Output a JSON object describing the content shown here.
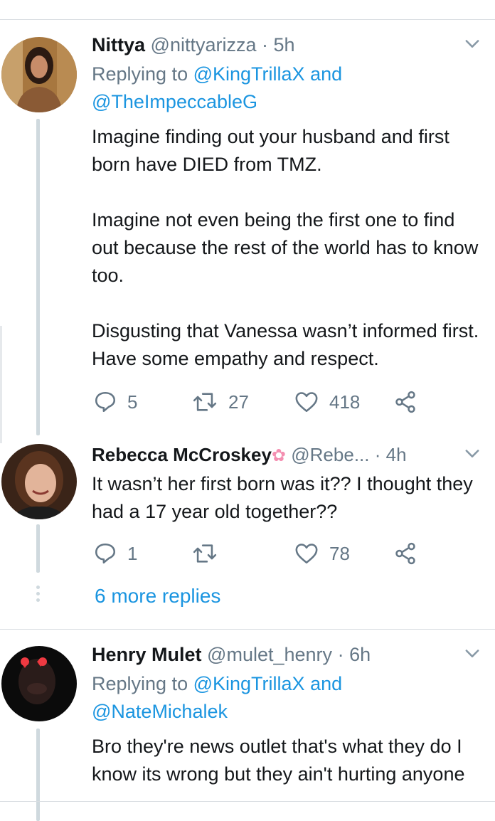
{
  "tweets": [
    {
      "name": "Nittya",
      "handle": "@nittyarizza",
      "time": "5h",
      "replying_prefix": "Replying to",
      "replying_to_1": "@KingTrillaX",
      "replying_and": "and",
      "replying_to_2": "@TheImpeccableG",
      "text": "Imagine finding out your husband and first born have DIED from TMZ.\n\nImagine not even being the first one to find out because the rest of the world has to know too.\n\nDisgusting that Vanessa wasn’t informed first. Have some empathy and respect.",
      "replies": "5",
      "retweets": "27",
      "likes": "418"
    },
    {
      "name": "Rebecca McCroskey",
      "handle": "@Rebe...",
      "time": "4h",
      "text": "It wasn’t her first born was it?? I thought they had a 17 year old together??",
      "replies": "1",
      "retweets": "",
      "likes": "78"
    },
    {
      "name": "Henry Mulet",
      "handle": "@mulet_henry",
      "time": "6h",
      "replying_prefix": "Replying to",
      "replying_to_1": "@KingTrillaX",
      "replying_and": "and",
      "replying_to_2": "@NateMichalek",
      "text": "Bro they're news outlet that's what they do I know its wrong but they ain't hurting anyone"
    }
  ],
  "more_replies": "6 more replies",
  "separator_dot": "·",
  "colors": {
    "accent": "#1b95e0",
    "muted": "#657786",
    "line": "#cfd9de"
  },
  "icons": [
    "reply-icon",
    "retweet-icon",
    "like-icon",
    "share-icon",
    "chevron-down-icon",
    "flower-emoji-icon"
  ]
}
